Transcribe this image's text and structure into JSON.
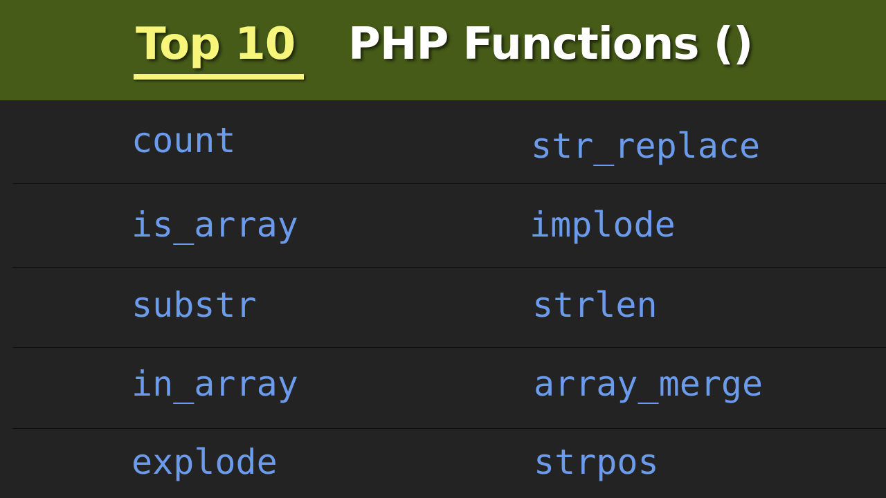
{
  "header": {
    "accent": "Top 10",
    "title": "PHP Functions ()"
  },
  "colors": {
    "banner_bg": "#465b18",
    "accent": "#f7f67a",
    "title": "#ffffff",
    "list_bg": "#232323",
    "function_text": "#6b9bea"
  },
  "functions": [
    {
      "left": "count",
      "right": "str_replace"
    },
    {
      "left": "is_array",
      "right": "implode"
    },
    {
      "left": "substr",
      "right": "strlen"
    },
    {
      "left": "in_array",
      "right": "array_merge"
    },
    {
      "left": "explode",
      "right": "strpos"
    }
  ]
}
